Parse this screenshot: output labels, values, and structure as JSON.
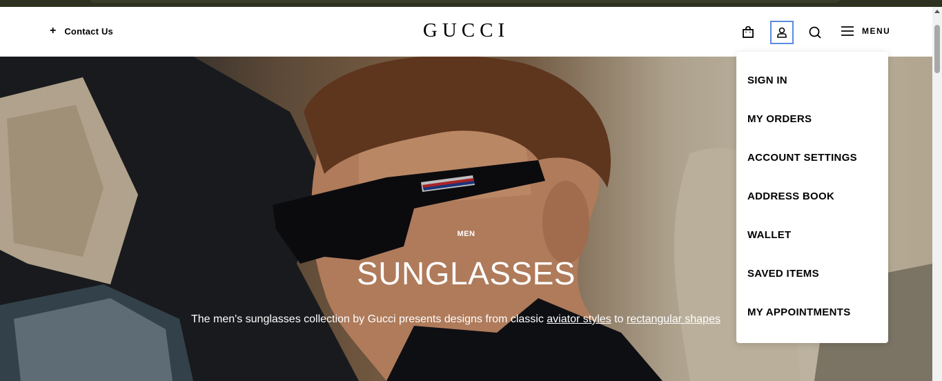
{
  "header": {
    "contact_plus": "+",
    "contact_label": "Contact Us",
    "logo": "GUCCI",
    "menu_label": "MENU"
  },
  "icons": {
    "bag": "shopping-bag-icon",
    "user": "user-icon",
    "search": "search-icon",
    "menu": "hamburger-icon"
  },
  "hero": {
    "eyebrow": "MEN",
    "title": "SUNGLASSES",
    "description_prefix": "The men's sunglasses collection by Gucci presents designs from classic ",
    "link_aviator": "aviator styles",
    "description_middle": " to ",
    "link_rectangular": "rectangular shapes"
  },
  "account_menu": {
    "items": [
      "SIGN IN",
      "MY ORDERS",
      "ACCOUNT SETTINGS",
      "ADDRESS BOOK",
      "WALLET",
      "SAVED ITEMS",
      "MY APPOINTMENTS"
    ]
  },
  "colors": {
    "focus_ring": "#5a8be0",
    "text": "#000000",
    "hero_text": "#ffffff"
  }
}
